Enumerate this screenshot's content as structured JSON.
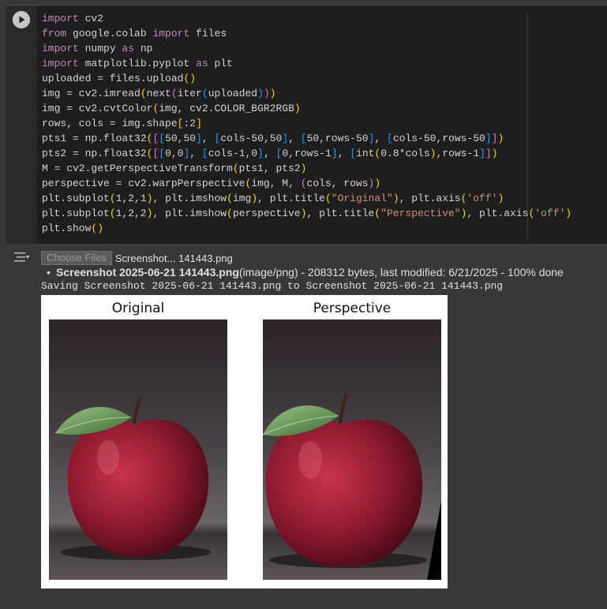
{
  "code_cell": {
    "run_button_label": "Run cell",
    "lines": [
      "import cv2",
      "from google.colab import files",
      "import numpy as np",
      "import matplotlib.pyplot as plt",
      "uploaded = files.upload()",
      "img = cv2.imread(next(iter(uploaded)))",
      "img = cv2.cvtColor(img, cv2.COLOR_BGR2RGB)",
      "rows, cols = img.shape[:2]",
      "pts1 = np.float32([[50,50], [cols-50,50], [50,rows-50], [cols-50,rows-50]])",
      "pts2 = np.float32([[0,0], [cols-1,0], [0,rows-1], [int(0.8*cols),rows-1]])",
      "M = cv2.getPerspectiveTransform(pts1, pts2)",
      "perspective = cv2.warpPerspective(img, M, (cols, rows))",
      "plt.subplot(1,2,1), plt.imshow(img), plt.title(\"Original\"), plt.axis('off')",
      "plt.subplot(1,2,2), plt.imshow(perspective), plt.title(\"Perspective\"), plt.axis('off')",
      "plt.show()"
    ]
  },
  "output": {
    "choose_files_label": "Choose Files",
    "selected_file": "Screenshot... 141443.png",
    "file_name": "Screenshot 2025-06-21 141443.png",
    "file_details": "(image/png) - 208312 bytes, last modified: 6/21/2025 - 100% done",
    "saving_text": "Saving Screenshot 2025-06-21 141443.png to Screenshot 2025-06-21 141443.png",
    "figure": {
      "left_title": "Original",
      "right_title": "Perspective"
    }
  },
  "colors": {
    "cell_background": "#1e1e1e",
    "page_background": "#383838",
    "keyword": "#c586c0",
    "string": "#ce9178",
    "bracket_1": "#ffd700",
    "bracket_2": "#da70d6",
    "bracket_3": "#179fff"
  }
}
